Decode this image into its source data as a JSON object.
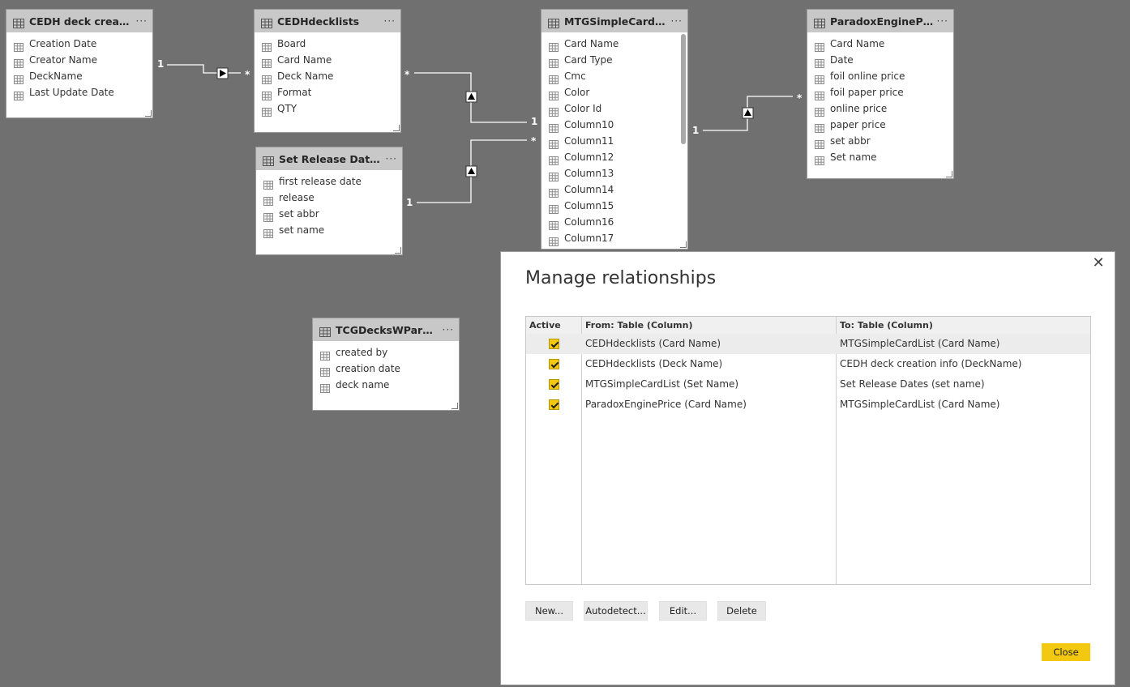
{
  "tables": [
    {
      "title": "CEDH deck creation i...",
      "fields": [
        "Creation Date",
        "Creator Name",
        "DeckName",
        "Last Update Date"
      ]
    },
    {
      "title": "CEDHdecklists",
      "fields": [
        "Board",
        "Card Name",
        "Deck Name",
        "Format",
        "QTY"
      ]
    },
    {
      "title": "Set Release Dates",
      "fields": [
        "first release date",
        "release",
        "set abbr",
        "set name"
      ]
    },
    {
      "title": "MTGSimpleCardList",
      "fields": [
        "Card Name",
        "Card Type",
        "Cmc",
        "Color",
        "Color Id",
        "Column10",
        "Column11",
        "Column12",
        "Column13",
        "Column14",
        "Column15",
        "Column16",
        "Column17"
      ]
    },
    {
      "title": "ParadoxEnginePrice",
      "fields": [
        "Card Name",
        "Date",
        "foil online price",
        "foil paper price",
        "online price",
        "paper price",
        "set abbr",
        "Set name"
      ]
    },
    {
      "title": "TCGDecksWParadox...",
      "fields": [
        "created by",
        "creation date",
        "deck name"
      ]
    }
  ],
  "more_glyph": "···",
  "cardinality": {
    "one": "1",
    "many": "*"
  },
  "dialog": {
    "title": "Manage relationships",
    "close_glyph": "✕",
    "columns": {
      "active": "Active",
      "from": "From: Table (Column)",
      "to": "To: Table (Column)"
    },
    "rows": [
      {
        "active": true,
        "from": "CEDHdecklists (Card Name)",
        "to": "MTGSimpleCardList (Card Name)"
      },
      {
        "active": true,
        "from": "CEDHdecklists (Deck Name)",
        "to": "CEDH deck creation info (DeckName)"
      },
      {
        "active": true,
        "from": "MTGSimpleCardList (Set Name)",
        "to": "Set Release Dates (set name)"
      },
      {
        "active": true,
        "from": "ParadoxEnginePrice (Card Name)",
        "to": "MTGSimpleCardList (Card Name)"
      }
    ],
    "buttons": {
      "new": "New...",
      "autodetect": "Autodetect...",
      "edit": "Edit...",
      "delete": "Delete",
      "close": "Close"
    }
  },
  "colors": {
    "canvas": "#707070",
    "accent": "#f2c811",
    "header": "#c8c8c8"
  }
}
